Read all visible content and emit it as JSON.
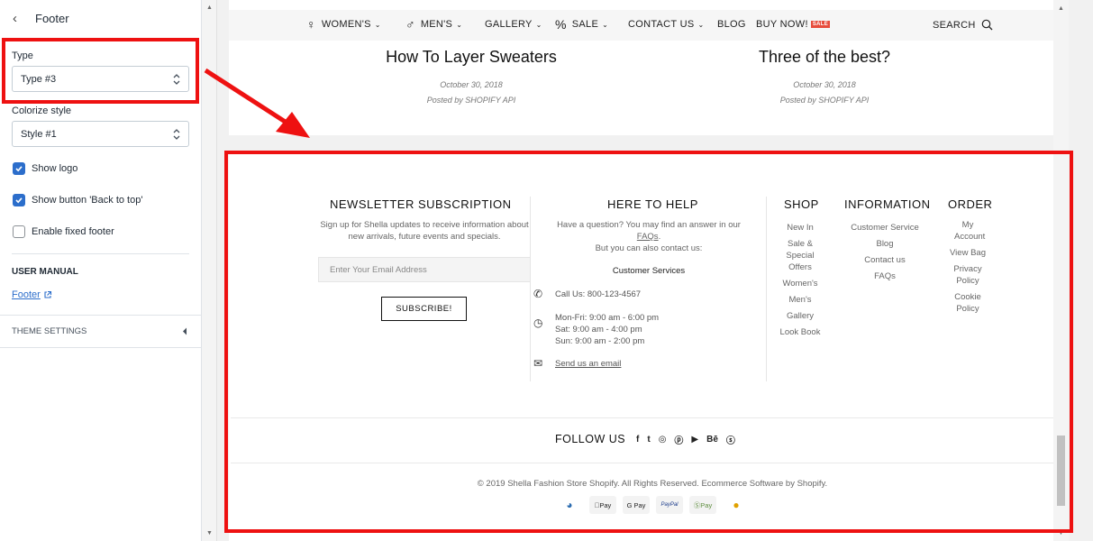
{
  "sidebar": {
    "back_glyph": "‹",
    "title": "Footer",
    "type_field": {
      "label": "Type",
      "value": "Type #3"
    },
    "colorize_field": {
      "label": "Colorize style",
      "value": "Style #1"
    },
    "checkboxes": [
      {
        "label": "Show logo",
        "checked": true
      },
      {
        "label": "Show button 'Back to top'",
        "checked": true
      },
      {
        "label": "Enable fixed footer",
        "checked": false
      }
    ],
    "user_manual_title": "USER MANUAL",
    "user_manual_link": "Footer",
    "theme_settings": "THEME SETTINGS"
  },
  "nav": {
    "womens": "WOMEN'S",
    "mens": "MEN'S",
    "gallery": "GALLERY",
    "sale": "SALE",
    "contact": "CONTACT US",
    "blog": "BLOG",
    "buy_now": "BUY NOW!",
    "sale_badge": "SALE",
    "search": "SEARCH"
  },
  "posts": [
    {
      "title": "How To Layer Sweaters",
      "date": "October 30, 2018",
      "author": "Posted by SHOPIFY API"
    },
    {
      "title": "Three of the best?",
      "date": "October 30, 2018",
      "author": "Posted by SHOPIFY API"
    }
  ],
  "footer": {
    "newsletter": {
      "title": "NEWSLETTER SUBSCRIPTION",
      "text": "Sign up for Shella updates to receive information about new arrivals, future events and specials.",
      "placeholder": "Enter Your Email Address",
      "button": "SUBSCRIBE!"
    },
    "help": {
      "title": "HERE TO HELP",
      "line1": "Have a question? You may find an answer in our",
      "faq_link": "FAQs",
      "line2": "But you can also contact us:",
      "customer_services": "Customer Services",
      "call": "Call Us: 800-123-4567",
      "hours_1": "Mon-Fri: 9:00 am - 6:00 pm",
      "hours_2": "Sat: 9:00 am - 4:00 pm",
      "hours_3": "Sun: 9:00 am - 2:00 pm",
      "email_link": "Send us an email"
    },
    "shop": {
      "title": "SHOP",
      "items": [
        "New In",
        "Sale & Special Offers",
        "Women's",
        "Men's",
        "Gallery",
        "Look Book"
      ]
    },
    "information": {
      "title": "INFORMATION",
      "items": [
        "Customer Service",
        "Blog",
        "Contact us",
        "FAQs"
      ]
    },
    "order": {
      "title": "ORDER",
      "items": [
        "My Account",
        "View Bag",
        "Privacy Policy",
        "Cookie Policy"
      ]
    },
    "follow": "FOLLOW US",
    "copyright": "© 2019 Shella Fashion Store Shopify. All Rights Reserved. Ecommerce Software by Shopify.",
    "payments": [
      "◕",
      "Pay",
      "G Pay",
      "PayPal",
      "ⓈPay",
      "●"
    ],
    "social_icons": [
      "f",
      "t",
      "◎",
      "ⓟ",
      "▶",
      "Bē",
      "ⓢ"
    ]
  },
  "colors": {
    "accent": "#2c6ecb",
    "highlight": "#ee1111",
    "sale": "#e74c3c"
  }
}
